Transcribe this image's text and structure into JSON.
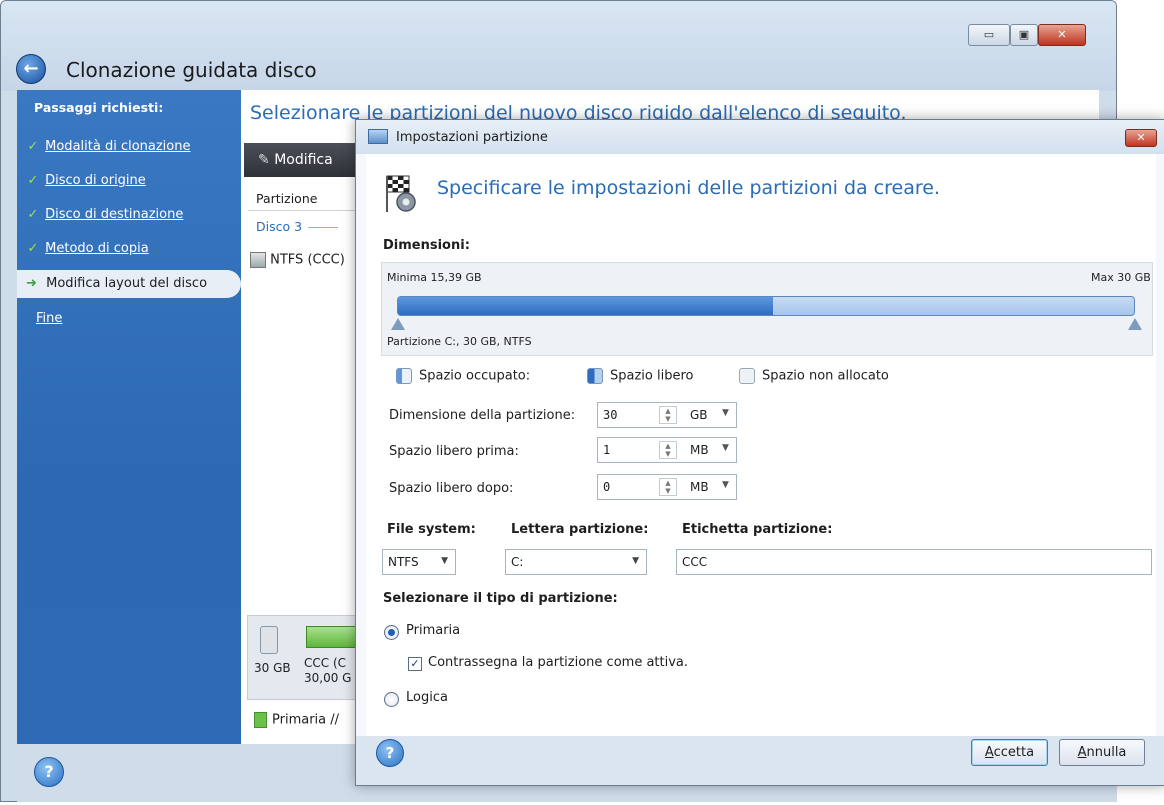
{
  "main_window": {
    "title": "Clonazione guidata disco",
    "controls": {
      "minimize": "▭",
      "maximize": "▣",
      "close": "✕"
    }
  },
  "sidebar": {
    "title": "Passaggi richiesti:",
    "steps": [
      {
        "label": "Modalità di clonazione",
        "state": "done"
      },
      {
        "label": "Disco di origine",
        "state": "done"
      },
      {
        "label": "Disco di destinazione",
        "state": "done"
      },
      {
        "label": "Metodo di copia",
        "state": "done"
      },
      {
        "label": "Modifica layout del disco",
        "state": "current"
      },
      {
        "label": "Fine",
        "state": "pending"
      }
    ]
  },
  "main": {
    "heading": "Selezionare le partizioni del nuovo disco rigido dall'elenco di seguito.",
    "toolbar_edit": "Modifica",
    "column_partition": "Partizione",
    "disk_group": "Disco 3",
    "row_label": "NTFS (CCC)",
    "disk_size": "30 GB",
    "disk_part_name": "CCC (C",
    "disk_part_size": "30,00 G",
    "legend": "Primaria //"
  },
  "dialog": {
    "title": "Impostazioni partizione",
    "close": "✕",
    "heading": "Specificare le impostazioni delle partizioni da creare.",
    "dimensions_label": "Dimensioni:",
    "min_text": "Minima 15,39 GB",
    "max_text": "Max 30 GB",
    "used_fraction": 0.51,
    "partition_caption": "Partizione C:, 30 GB, NTFS",
    "legend": {
      "used": "Spazio occupato:",
      "free": "Spazio libero",
      "unallocated": "Spazio non allocato"
    },
    "size_label": "Dimensione della partizione:",
    "size_value": "30",
    "size_unit": "GB",
    "free_before_label": "Spazio libero prima:",
    "free_before_value": "1",
    "free_before_unit": "MB",
    "free_after_label": "Spazio libero dopo:",
    "free_after_value": "0",
    "free_after_unit": "MB",
    "fs_label": "File system:",
    "fs_value": "NTFS",
    "letter_label": "Lettera partizione:",
    "letter_value": "C:",
    "volume_label_label": "Etichetta partizione:",
    "volume_label_value": "CCC",
    "ptype_label": "Selezionare il tipo di partizione:",
    "primary": "Primaria",
    "mark_active": "Contrassegna la partizione come attiva.",
    "logical": "Logica",
    "ok_accel": "A",
    "ok_rest": "ccetta",
    "cancel_accel": "A",
    "cancel_rest": "nnulla",
    "help": "?"
  },
  "colors": {
    "sidebar_blue": "#3372bd",
    "heading_blue": "#2b6cb5",
    "used_space": "#3f7fd0",
    "free_space": "#b5cfee",
    "primary_green": "#6cc04c"
  }
}
